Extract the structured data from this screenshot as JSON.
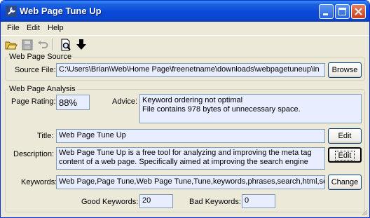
{
  "window": {
    "title": "Web Page Tune Up"
  },
  "menu": [
    "File",
    "Edit",
    "Help"
  ],
  "toolbar": {
    "icons": [
      "open-folder-icon",
      "save-icon",
      "undo-icon",
      "preview-icon",
      "download-icon"
    ]
  },
  "source_group": {
    "legend": "Web Page Source",
    "source_label": "Source File:",
    "source_value": "C:\\Users\\Brian\\Web\\Home Page\\freenetname\\downloads\\webpagetuneup\\in",
    "browse_label": "Browse"
  },
  "analysis_group": {
    "legend": "Web Page Analysis",
    "rating_label": "Page Rating:",
    "rating_value": "88%",
    "advice_label": "Advice:",
    "advice_lines": [
      "Keyword ordering not optimal",
      "File contains 978 bytes of unnecessary space."
    ],
    "title_label": "Title:",
    "title_value": "Web Page Tune Up",
    "title_edit": "Edit",
    "description_label": "Description:",
    "description_value": "Web Page Tune Up is a free tool for analyzing and improving the meta tag content of a web page. Specifically aimed at improving the search engine",
    "description_edit": "Edit",
    "keywords_label": "Keywords:",
    "keywords_value": "Web Page,Page Tune,Web Page Tune,Tune,keywords,phrases,search,html,se",
    "keywords_change": "Change",
    "good_label": "Good Keywords:",
    "good_value": "20",
    "bad_label": "Bad Keywords:",
    "bad_value": "0"
  },
  "colors": {
    "titlebar": "#0a48d8",
    "window_bg": "#ece9d8",
    "readonly_bg": "#e8eeff"
  }
}
